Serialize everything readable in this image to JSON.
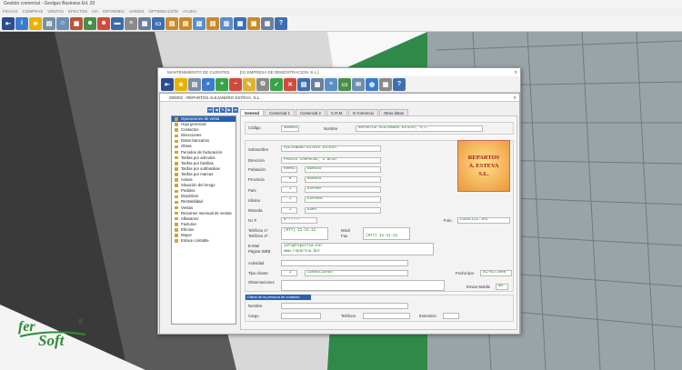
{
  "app": {
    "title": "Gestión comercial - Geslgus Business Ed. 20"
  },
  "menu": [
    "FICHAS",
    "COMPRAS",
    "VENTAS",
    "EFECTOS",
    "IVA",
    "INFORMES",
    "VARIOS",
    "OPTIMIZACIÓN",
    "AYUDA"
  ],
  "logo": {
    "text1": "fer",
    "text2": "Soft",
    "reg": "®"
  },
  "window1": {
    "title": "MANTENIMIENTO DE CLIENTES",
    "subtitle": "[01 EMPRESA DE DEMOSTRACION, S.L.]"
  },
  "window2": {
    "title": "000002 - REPARTOS ALEJANDRO ESTEVA, S.L."
  },
  "tree": [
    "Operaciones de venta",
    "Hoja gerencial",
    "Contactos",
    "Direcciones",
    "Datos bancarios",
    "Obras",
    "Periodos de facturación",
    "Tarifas por artículos",
    "Tarifas por familias",
    "Tarifas por subfamilias",
    "Tarifas por marcas",
    "Avisos",
    "Situación del riesgo",
    "Pedidos",
    "Depósitos",
    "Rentabilidad",
    "Ventas",
    "Resumen mensual de ventas",
    "Albaranes",
    "Facturas",
    "Efectos",
    "Mayor",
    "Enlace contable"
  ],
  "tabs": [
    "General",
    "Comercial 1",
    "Comercial 2",
    "C.R.M.",
    "E-Comercio",
    "Otros datos"
  ],
  "form": {
    "codigo_label": "Código",
    "codigo": "000002",
    "nombre_label": "Nombre",
    "nombre": "REPARTOS ALEJANDRO ESTEVA, S.L.",
    "subnombre_label": "Subnombre",
    "subnombre": "ALEJANDRO ESTEVA ESTEVA",
    "direccion_label": "Dirección",
    "direccion": "PASAJE CAMPECHE, 2 BAJO",
    "poblacion_label": "Población",
    "poblacion_cp": "09001",
    "poblacion": "BURGOS",
    "provincia_label": "Provincia",
    "provincia_cod": "9",
    "provincia": "BURGOS",
    "pais_label": "País",
    "pais_cod": "1",
    "pais": "ESPAÑA",
    "idioma_label": "Idioma",
    "idioma_cod": "1",
    "idioma": "ESPAÑOL",
    "moneda_label": "Moneda",
    "moneda_cod": "1",
    "moneda": "EURO",
    "nif_label": "N.I.F.",
    "nif": "B-?????",
    "tel1_label": "Teléfono 1º",
    "tel2_label": "Teléfono 2º",
    "telefono": "(977) 11-11-11",
    "movil_label": "Móvil",
    "fax_label": "Fax",
    "fax": "(977) 11-11-11",
    "email_label": "E-Mail",
    "web_label": "Página WEB",
    "email": "info@repartoa.bur",
    "web": "www.repartoa.bur",
    "actividad_label": "Actividad",
    "tipo_label": "Tipo cliente",
    "tipo_cod": "1",
    "tipo": "CONSOLIDADO",
    "fechatipo_label": "Fecha tipo",
    "fechatipo": "01/01/2008",
    "obs_label": "Observaciones",
    "enviar_label": "Enviar Mobile",
    "enviar": "NO",
    "foto_label": "Foto",
    "foto": "LOGOCLI2.JPG",
    "photo_lines": [
      "REPARTOS",
      "A. ESTEVA",
      "S.L."
    ]
  },
  "contacto": {
    "header": "Datos de la persona de contacto",
    "nombre_label": "Nombre",
    "cargo_label": "Cargo",
    "telefono_label": "Teléfono",
    "extension_label": "Extensión"
  }
}
